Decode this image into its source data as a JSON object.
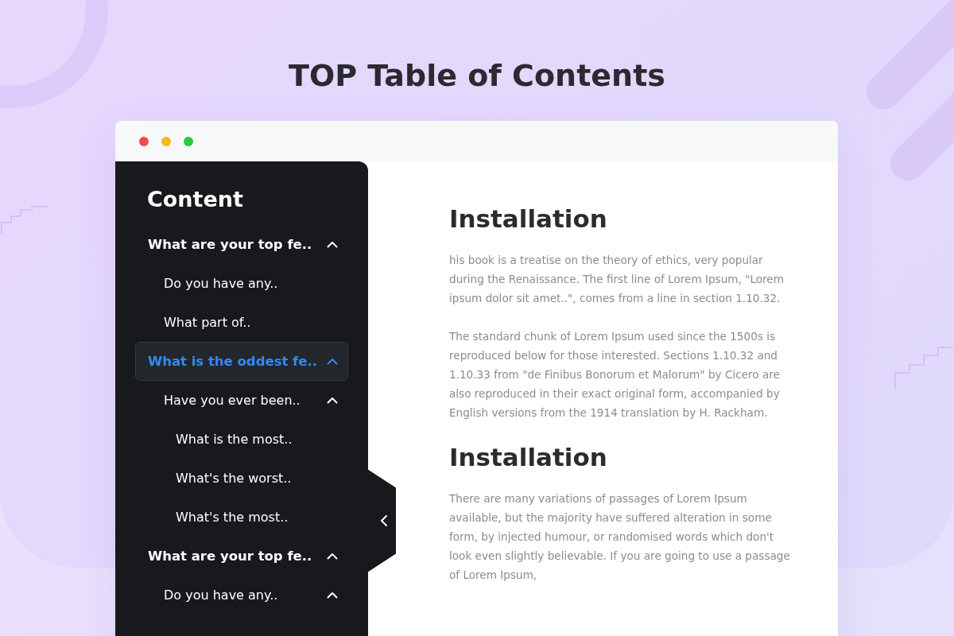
{
  "title": "TOP Table of Contents",
  "sidebar": {
    "heading": "Content",
    "items": [
      {
        "label": "What are your top fe..",
        "selected": false,
        "expanded": true,
        "children": [
          {
            "label": "Do you have any..",
            "selected": false
          },
          {
            "label": "What part of..",
            "selected": false
          }
        ]
      },
      {
        "label": "What is the oddest fe..",
        "selected": true,
        "expanded": true,
        "children": [
          {
            "label": "Have you ever been..",
            "selected": false,
            "expanded": true,
            "children": [
              {
                "label": "What is the most..",
                "selected": false
              },
              {
                "label": "What's the worst..",
                "selected": false
              },
              {
                "label": "What's the most..",
                "selected": false
              }
            ]
          }
        ]
      },
      {
        "label": "What are your top fe..",
        "selected": false,
        "expanded": true,
        "children": [
          {
            "label": "Do you have any..",
            "selected": false,
            "expanded": true
          }
        ]
      }
    ]
  },
  "content": {
    "sections": [
      {
        "heading": "Installation",
        "paragraphs": [
          "his book is a treatise on the theory of ethics, very popular during the Renaissance. The first line of Lorem Ipsum, \"Lorem ipsum dolor sit amet..\", comes from a line in section 1.10.32.",
          "The standard chunk of Lorem Ipsum used since the 1500s is reproduced below for those interested. Sections 1.10.32 and 1.10.33 from \"de Finibus Bonorum et Malorum\" by Cicero are also reproduced in their exact original form, accompanied by English versions from the 1914 translation by H. Rackham."
        ]
      },
      {
        "heading": "Installation",
        "paragraphs": [
          "There are many variations of passages of Lorem Ipsum available, but the majority have suffered alteration in some form, by injected humour, or randomised words which don't look even slightly believable. If you are going to use a passage of Lorem Ipsum,"
        ]
      }
    ]
  }
}
